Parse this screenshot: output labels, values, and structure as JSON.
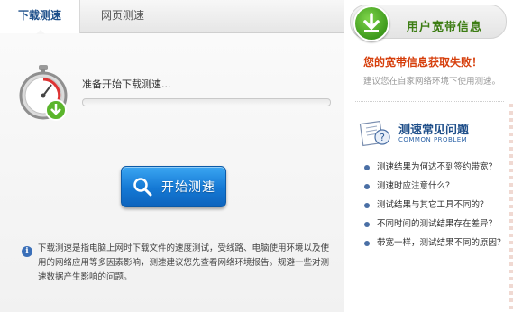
{
  "tabs": [
    {
      "label": "下载测速",
      "active": true
    },
    {
      "label": "网页测速",
      "active": false
    }
  ],
  "main": {
    "status_text": "准备开始下载测速...",
    "progress": 0,
    "start_button_label": "开始测速",
    "info_text": "下载测速是指电脑上网时下载文件的速度测试，受线路、电脑使用环境以及使用的网络应用等多因素影响，测速建议您先查看网络环境报告。规避一些对测速数据产生影响的问题。"
  },
  "sidebar": {
    "user_info_title": "用户宽带信息",
    "error_title": "您的宽带信息获取失败！",
    "error_hint": "建议您在自家网络环境下使用测速。",
    "faq_title": "测速常见问题",
    "faq_subtitle": "COMMON PROBLEM",
    "faq_items": [
      "测速结果为何达不到签约带宽？",
      "测速时应注意什么？",
      "测试结果与其它工具不同的？",
      "不同时间的测试结果存在差异？",
      "带宽一样，测试结果不同的原因？"
    ]
  },
  "colors": {
    "accent_blue": "#1478d4",
    "progress_blue": "#3a86d6",
    "brand_green": "#3d7d14",
    "error_red": "#d63e0b",
    "link_blue": "#1f4f8a"
  },
  "icons": {
    "stopwatch": "stopwatch-icon",
    "search": "search-icon",
    "info": "info-icon",
    "download": "download-arrow-icon",
    "faq": "faq-icon"
  }
}
